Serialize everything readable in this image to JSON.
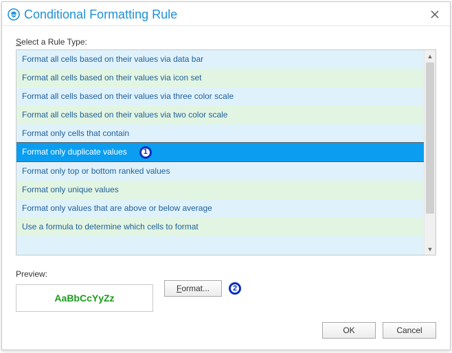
{
  "dialog": {
    "title": "Conditional Formatting Rule",
    "close_glyph": "×"
  },
  "ruleTypeLabel": {
    "prefix": "S",
    "rest": "elect a Rule Type:"
  },
  "ruleTypes": [
    {
      "label": "Format all cells based on their values via data bar",
      "selected": false
    },
    {
      "label": "Format all cells based on their values via icon set",
      "selected": false
    },
    {
      "label": "Format all cells based on their values via three color scale",
      "selected": false
    },
    {
      "label": "Format all cells based on their values via two color scale",
      "selected": false
    },
    {
      "label": "Format only cells that contain",
      "selected": false
    },
    {
      "label": "Format only duplicate values",
      "selected": true
    },
    {
      "label": "Format only top or bottom ranked values",
      "selected": false
    },
    {
      "label": "Format only unique values",
      "selected": false
    },
    {
      "label": "Format only values that are above or below average",
      "selected": false
    },
    {
      "label": "Use a formula to determine which cells to format",
      "selected": false
    }
  ],
  "callouts": {
    "one": "1",
    "two": "2"
  },
  "preview": {
    "label": "Preview:",
    "sample": "AaBbCcYyZz",
    "sample_color": "#1b9b1b"
  },
  "buttons": {
    "format": "Format...",
    "format_mnemonic": "F",
    "ok": "OK",
    "cancel": "Cancel"
  }
}
